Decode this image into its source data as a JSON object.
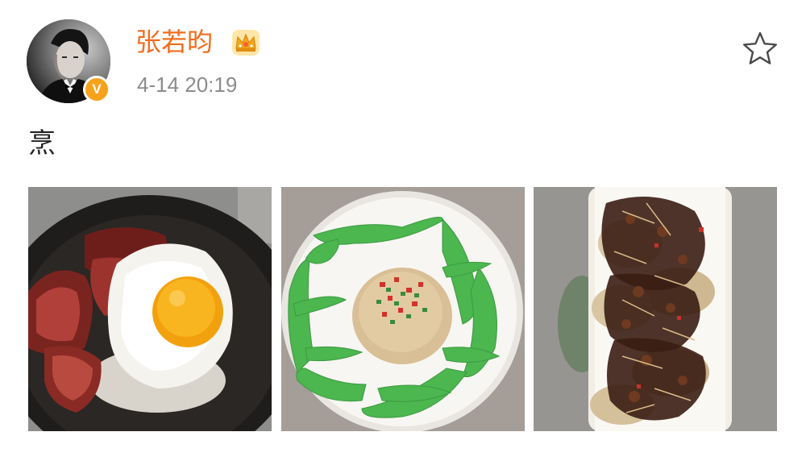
{
  "post": {
    "author": {
      "name": "张若昀",
      "verified_badge": "V",
      "avatar_icon": "avatar-photo",
      "badge_icon": "crown-icon"
    },
    "timestamp": "4-14 20:19",
    "text": "烹",
    "actions": {
      "favorite_icon": "star-outline-icon"
    },
    "photos": [
      {
        "name": "steak-egg-rice-photo"
      },
      {
        "name": "peas-rice-plate-photo"
      },
      {
        "name": "crispy-fish-platter-photo"
      }
    ]
  },
  "colors": {
    "username": "#f26d1f",
    "timestamp": "#8c8c8c",
    "verified": "#f7a21b",
    "text": "#222222"
  }
}
